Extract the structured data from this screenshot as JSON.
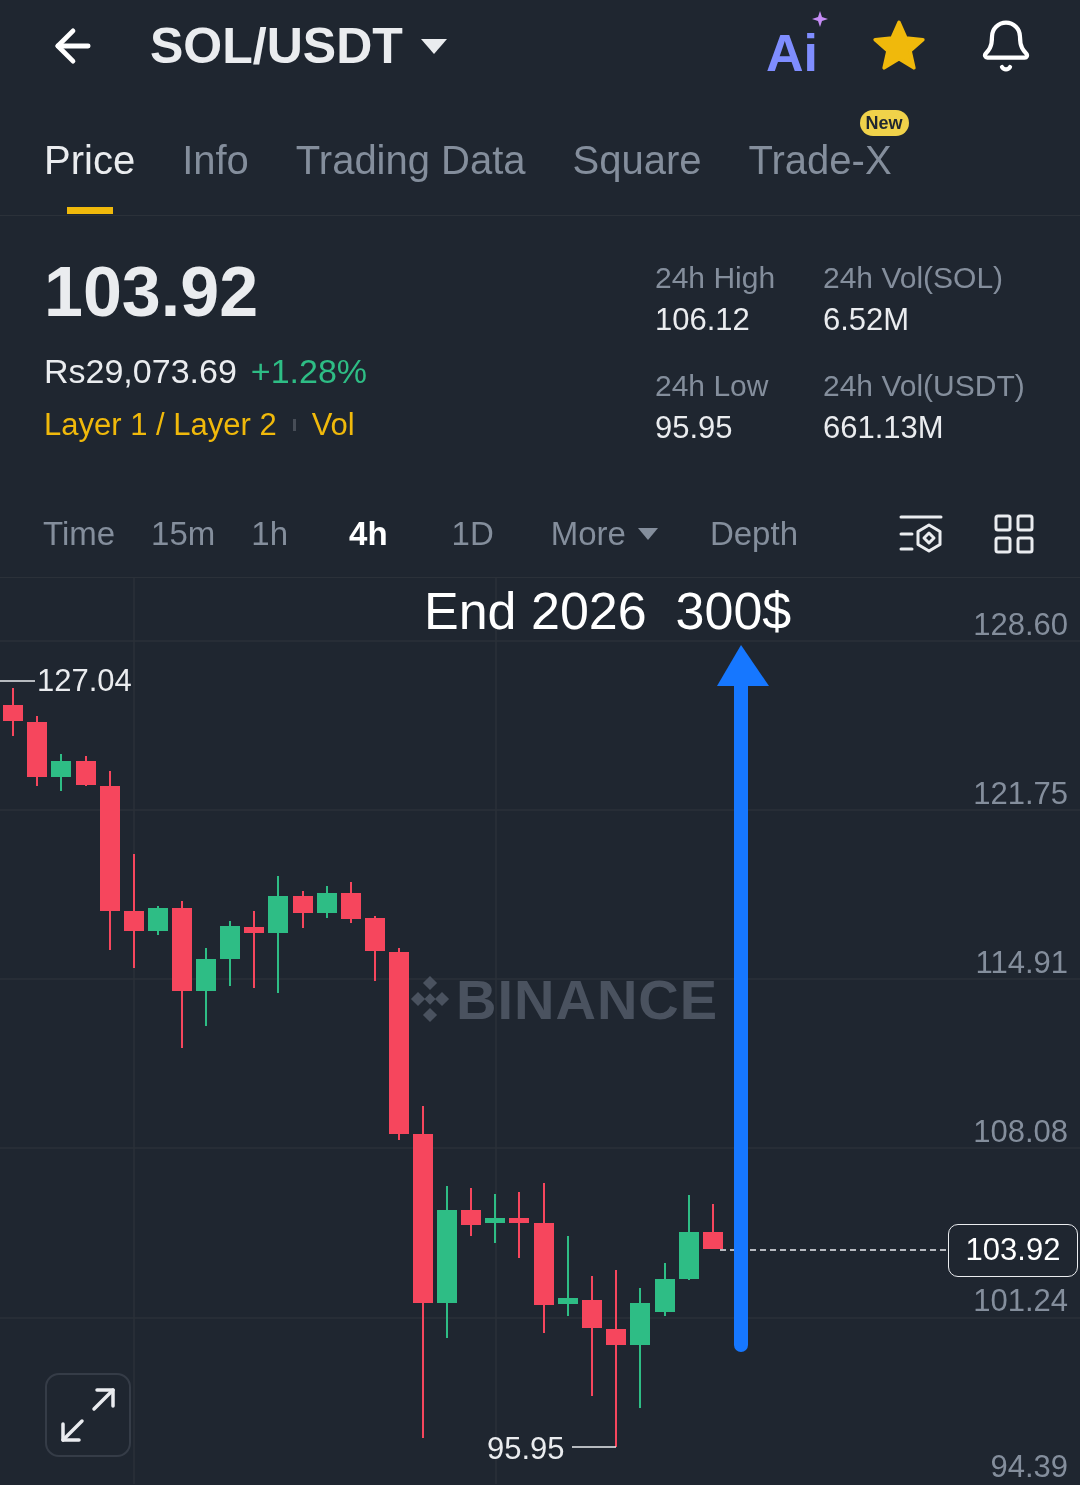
{
  "header": {
    "pair": "SOL/USDT",
    "ai_label": "Ai",
    "favorite": true
  },
  "tabs": [
    {
      "label": "Price",
      "selected": true
    },
    {
      "label": "Info",
      "selected": false
    },
    {
      "label": "Trading Data",
      "selected": false
    },
    {
      "label": "Square",
      "selected": false
    },
    {
      "label": "Trade-X",
      "selected": false,
      "badge": "New"
    }
  ],
  "ticker": {
    "price": "103.92",
    "fiat_price": "Rs29,073.69",
    "change": "+1.28%",
    "tags": [
      "Layer 1 / Layer 2",
      "Vol"
    ]
  },
  "stats": [
    {
      "label": "24h High",
      "value": "106.12"
    },
    {
      "label": "24h Vol(SOL)",
      "value": "6.52M"
    },
    {
      "label": "24h Low",
      "value": "95.95"
    },
    {
      "label": "24h Vol(USDT)",
      "value": "661.13M"
    }
  ],
  "intervals": [
    {
      "label": "Time",
      "kind": "option",
      "selected": false
    },
    {
      "label": "15m",
      "kind": "option",
      "selected": false
    },
    {
      "label": "1h",
      "kind": "option",
      "selected": false
    },
    {
      "label": "4h",
      "kind": "option",
      "selected": true
    },
    {
      "label": "1D",
      "kind": "option",
      "selected": false
    },
    {
      "label": "More",
      "kind": "dropdown",
      "selected": false
    },
    {
      "label": "Depth",
      "kind": "option",
      "selected": false
    }
  ],
  "chart": {
    "annotation": "End 2026  300$",
    "watermark": "BINANCE",
    "high_label": "127.04",
    "low_label": "95.95",
    "last_price": "103.92",
    "y_axis_labels": [
      "128.60",
      "121.75",
      "114.91",
      "108.08",
      "101.24",
      "94.39"
    ]
  }
}
